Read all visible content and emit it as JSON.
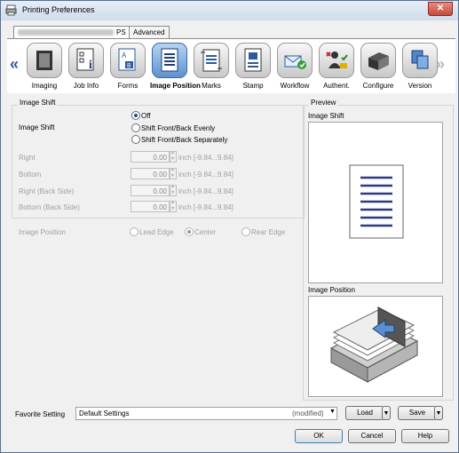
{
  "window": {
    "title": "Printing Preferences",
    "close": "✕"
  },
  "tabs": [
    {
      "label": "PS"
    },
    {
      "label": "Advanced"
    }
  ],
  "iconbar": {
    "left_arrow": "«",
    "right_arrow": "»",
    "items": [
      {
        "label": "Imaging",
        "icon": "imaging-icon"
      },
      {
        "label": "Job Info",
        "icon": "job-info-icon"
      },
      {
        "label": "Forms",
        "icon": "forms-icon"
      },
      {
        "label": "Image Position",
        "icon": "image-position-icon",
        "selected": true
      },
      {
        "label": "Marks",
        "icon": "marks-icon"
      },
      {
        "label": "Stamp",
        "icon": "stamp-icon"
      },
      {
        "label": "Workflow",
        "icon": "workflow-icon"
      },
      {
        "label": "Authent.",
        "icon": "authentication-icon"
      },
      {
        "label": "Configure",
        "icon": "configure-icon"
      },
      {
        "label": "Version",
        "icon": "version-icon"
      }
    ]
  },
  "image_shift": {
    "group_title": "Image Shift",
    "label": "Image Shift",
    "options": [
      "Off",
      "Shift Front/Back Evenly",
      "Shift Front/Back Separately"
    ],
    "selected": "Off",
    "fields": [
      {
        "label": "Right",
        "value": "0.00",
        "unit": "inch [-9.84...9.84]"
      },
      {
        "label": "Bottom",
        "value": "0.00",
        "unit": "inch [-9.84...9.84]"
      },
      {
        "label": "Right (Back Side)",
        "value": "0.00",
        "unit": "inch [-9.84...9.84]"
      },
      {
        "label": "Bottom (Back Side)",
        "value": "0.00",
        "unit": "inch [-9.84...9.84]"
      }
    ]
  },
  "image_position": {
    "label": "Image Position",
    "options": [
      "Lead Edge",
      "Center",
      "Rear Edge"
    ],
    "selected": "Center"
  },
  "preview": {
    "title": "Preview",
    "image_shift_label": "Image Shift",
    "image_position_label": "Image Position"
  },
  "footer": {
    "favorite_label": "Favorite Setting",
    "favorite_value": "Default Settings",
    "modified": "(modified)",
    "load": "Load",
    "save": "Save",
    "ok": "OK",
    "cancel": "Cancel",
    "help": "Help"
  },
  "colors": {
    "accent": "#3d6aa6",
    "arrow": "#2a5aa0"
  }
}
